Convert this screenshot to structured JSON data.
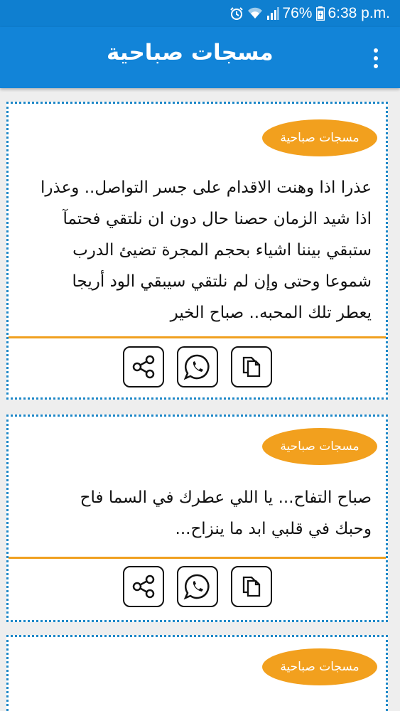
{
  "status_bar": {
    "battery": "76%",
    "time": "6:38 p.m.",
    "icons": [
      "alarm-icon",
      "wifi-icon",
      "signal-icon",
      "battery-icon"
    ]
  },
  "app_bar": {
    "title": "مسجات صباحية",
    "menu_icon": "more-vert-icon"
  },
  "cards": [
    {
      "badge": "مسجات صباحية",
      "lines": [
        "عذرا اذا وهنت الاقدام على جسر التواصل.. وعذرا",
        "اذا شيد الزمان حصنا حال دون ان نلتقي فحتمآ",
        "ستبقي بيننا اشياء بحجم المجرة تضيئ الدرب",
        "شموعا وحتى وإن لم نلتقي سيبقي الود أريجا",
        "يعطر تلك المحبه.. صباح الخير"
      ]
    },
    {
      "badge": "مسجات صباحية",
      "lines": [
        "صباح التفاح... يا اللي عطرك في السما فاح",
        "وحبك في قلبي ابد ما ينزاح..."
      ]
    },
    {
      "badge": "مسجات صباحية",
      "lines": []
    }
  ],
  "actions": [
    "share-icon",
    "whatsapp-icon",
    "copy-icon"
  ],
  "colors": {
    "status_bar": "#0f7fd0",
    "app_bar": "#1284d8",
    "badge": "#f2a01e",
    "divider": "#f0a020",
    "card_border": "#1e88c8"
  }
}
